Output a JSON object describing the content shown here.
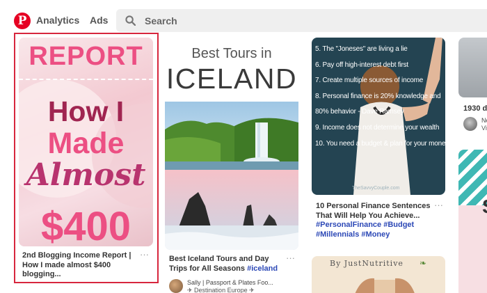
{
  "header": {
    "logo_glyph": "P",
    "nav": {
      "analytics": "Analytics",
      "ads": "Ads"
    },
    "search": {
      "placeholder": "Search"
    }
  },
  "pins": {
    "report": {
      "image_text": {
        "line1": "REPORT",
        "line2": "How I",
        "line3": "Made",
        "line4": "Almost",
        "line5": "$400"
      },
      "title": "2nd Blogging Income Report | How I made almost $400 blogging...",
      "more": "···",
      "highlight_color": "#d7263d"
    },
    "iceland": {
      "image_text": {
        "line1": "Best Tours in",
        "line2": "ICELAND"
      },
      "title_prefix": "Best Iceland Tours and Day Trips for All Seasons ",
      "hashtag": "#iceland",
      "more": "···",
      "user": "Sally | Passport & Plates Foo...",
      "board": "✈ Destination Europe ✈"
    },
    "finance": {
      "image_lines": [
        "5. The \"Joneses\" are living a lie",
        "6. Pay off high-interest debt first",
        "7. Create multiple sources of income",
        "8. Personal finance is 20% knowledge and",
        "80% behavior - Dave Ramsey",
        "9. Income does not determine your wealth",
        "10. You need a budget & plan for your money"
      ],
      "credit": "TheSavvyCouple.com",
      "title_prefix": "10 Personal Finance Sentences That Will Help You Achieve... ",
      "hashtags": "#PersonalFinance #Budget #Millennials #Money",
      "more": "···"
    },
    "nutrition": {
      "image_text": "By JustNutritive"
    },
    "partial_top": {
      "title": "1930 d",
      "user": "Ne",
      "board": "Vi"
    },
    "partial_bottom": {
      "image_letter": "S"
    }
  },
  "colors": {
    "brand": "#e60023",
    "hashtag": "#2c48b6",
    "pink": "#ec4f83",
    "finance_bg": "#244452"
  }
}
